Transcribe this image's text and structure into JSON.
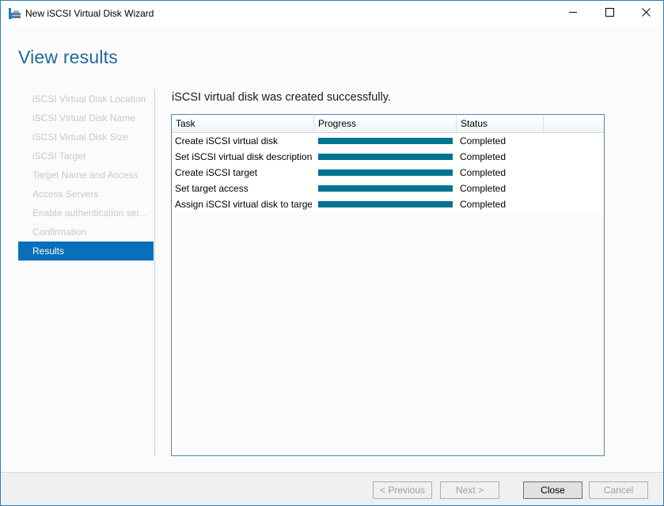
{
  "window": {
    "title": "New iSCSI Virtual Disk Wizard",
    "icon": "wizard-app-icon",
    "controls": [
      "minimize-icon",
      "maximize-icon",
      "close-icon"
    ]
  },
  "header": {
    "title": "View results"
  },
  "sidebar": {
    "steps": [
      {
        "label": "iSCSI Virtual Disk Location",
        "state": "disabled"
      },
      {
        "label": "iSCSI Virtual Disk Name",
        "state": "disabled"
      },
      {
        "label": "iSCSI Virtual Disk Size",
        "state": "disabled"
      },
      {
        "label": "iSCSI Target",
        "state": "disabled"
      },
      {
        "label": "Target Name and Access",
        "state": "disabled"
      },
      {
        "label": "Access Servers",
        "state": "disabled"
      },
      {
        "label": "Enable authentication ser...",
        "state": "disabled"
      },
      {
        "label": "Confirmation",
        "state": "disabled"
      },
      {
        "label": "Results",
        "state": "active"
      }
    ]
  },
  "main": {
    "message": "iSCSI virtual disk was created successfully.",
    "table": {
      "columns": [
        "Task",
        "Progress",
        "Status",
        ""
      ],
      "rows": [
        {
          "task": "Create iSCSI virtual disk",
          "progress_percent": 100,
          "status": "Completed"
        },
        {
          "task": "Set iSCSI virtual disk description",
          "progress_percent": 100,
          "status": "Completed"
        },
        {
          "task": "Create iSCSI target",
          "progress_percent": 100,
          "status": "Completed"
        },
        {
          "task": "Set target access",
          "progress_percent": 100,
          "status": "Completed"
        },
        {
          "task": "Assign iSCSI virtual disk to target",
          "progress_percent": 100,
          "status": "Completed"
        }
      ]
    }
  },
  "footer": {
    "previous_label": "< Previous",
    "next_label": "Next >",
    "close_label": "Close",
    "cancel_label": "Cancel"
  },
  "colors": {
    "accent": "#0a6fba",
    "progress": "#007391",
    "header_text": "#1e6a9a"
  }
}
